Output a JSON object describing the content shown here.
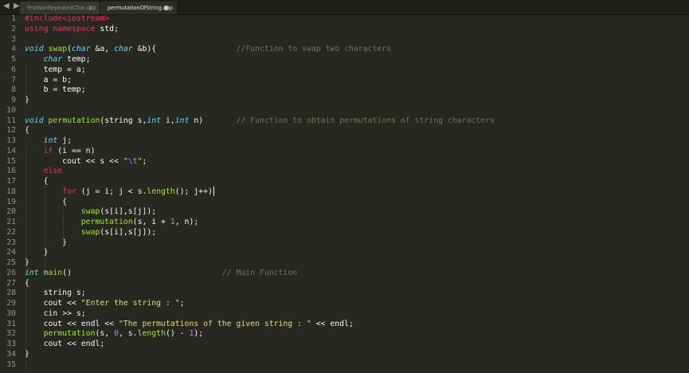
{
  "tabs": [
    {
      "label": "firstNonRepeatedChar.cpp",
      "active": false,
      "close_glyph": "×"
    },
    {
      "label": "permutationOfString.cpp",
      "active": true,
      "modified_glyph": "●"
    }
  ],
  "nav_arrows": "◀ ▶",
  "editor": {
    "caret_line": 18,
    "lines": [
      {
        "n": "1",
        "tokens": [
          {
            "t": "#include<iostream>",
            "c": "kw"
          }
        ]
      },
      {
        "n": "2",
        "tokens": [
          {
            "t": "using namespace",
            "c": "kw"
          },
          {
            "t": " std;",
            "c": "tx"
          }
        ]
      },
      {
        "n": "3",
        "tokens": []
      },
      {
        "n": "4",
        "tokens": [
          {
            "t": "void",
            "c": "ty"
          },
          {
            "t": " ",
            "c": "tx"
          },
          {
            "t": "swap",
            "c": "fn"
          },
          {
            "t": "(",
            "c": "tx"
          },
          {
            "t": "char",
            "c": "ty"
          },
          {
            "t": " &a, ",
            "c": "tx"
          },
          {
            "t": "char",
            "c": "ty"
          },
          {
            "t": " &b){                 ",
            "c": "tx"
          },
          {
            "t": "//Function to swap two characters",
            "c": "cm"
          }
        ]
      },
      {
        "n": "5",
        "tokens": [
          {
            "t": "    ",
            "c": "tx"
          },
          {
            "t": "char",
            "c": "ty"
          },
          {
            "t": " temp;",
            "c": "tx"
          }
        ]
      },
      {
        "n": "6",
        "tokens": [
          {
            "t": "    temp = a;",
            "c": "tx"
          }
        ]
      },
      {
        "n": "7",
        "tokens": [
          {
            "t": "    a = b;",
            "c": "tx"
          }
        ]
      },
      {
        "n": "8",
        "tokens": [
          {
            "t": "    b = temp;",
            "c": "tx"
          }
        ]
      },
      {
        "n": "9",
        "tokens": [
          {
            "t": "}",
            "c": "tx"
          }
        ]
      },
      {
        "n": "10",
        "tokens": []
      },
      {
        "n": "11",
        "tokens": [
          {
            "t": "void",
            "c": "ty"
          },
          {
            "t": " ",
            "c": "tx"
          },
          {
            "t": "permutation",
            "c": "fn"
          },
          {
            "t": "(string s,",
            "c": "tx"
          },
          {
            "t": "int",
            "c": "ty"
          },
          {
            "t": " i,",
            "c": "tx"
          },
          {
            "t": "int",
            "c": "ty"
          },
          {
            "t": " n)       ",
            "c": "tx"
          },
          {
            "t": "// Function to obtain permutations of string characters",
            "c": "cm"
          }
        ]
      },
      {
        "n": "12",
        "tokens": [
          {
            "t": "{",
            "c": "tx"
          }
        ]
      },
      {
        "n": "13",
        "tokens": [
          {
            "t": "    ",
            "c": "tx"
          },
          {
            "t": "int",
            "c": "ty"
          },
          {
            "t": " j;",
            "c": "tx"
          }
        ]
      },
      {
        "n": "14",
        "tokens": [
          {
            "t": "    ",
            "c": "tx"
          },
          {
            "t": "if",
            "c": "kw"
          },
          {
            "t": " (i == n)",
            "c": "tx"
          }
        ]
      },
      {
        "n": "15",
        "tokens": [
          {
            "t": "        cout << s << ",
            "c": "tx"
          },
          {
            "t": "\"",
            "c": "st"
          },
          {
            "t": "\\t",
            "c": "es"
          },
          {
            "t": "\"",
            "c": "st"
          },
          {
            "t": ";",
            "c": "tx"
          }
        ]
      },
      {
        "n": "16",
        "tokens": [
          {
            "t": "    ",
            "c": "tx"
          },
          {
            "t": "else",
            "c": "kw"
          }
        ]
      },
      {
        "n": "17",
        "tokens": [
          {
            "t": "    {",
            "c": "tx"
          }
        ]
      },
      {
        "n": "18",
        "tokens": [
          {
            "t": "        ",
            "c": "tx"
          },
          {
            "t": "for",
            "c": "kw"
          },
          {
            "t": " (j = i; j < s.",
            "c": "tx"
          },
          {
            "t": "length",
            "c": "fn"
          },
          {
            "t": "(); j++)",
            "c": "tx"
          }
        ]
      },
      {
        "n": "19",
        "tokens": [
          {
            "t": "        {",
            "c": "tx"
          }
        ]
      },
      {
        "n": "20",
        "tokens": [
          {
            "t": "            ",
            "c": "tx"
          },
          {
            "t": "swap",
            "c": "fn"
          },
          {
            "t": "(s[i],s[j]);",
            "c": "tx"
          }
        ]
      },
      {
        "n": "21",
        "tokens": [
          {
            "t": "            ",
            "c": "tx"
          },
          {
            "t": "permutation",
            "c": "fn"
          },
          {
            "t": "(s, i + ",
            "c": "tx"
          },
          {
            "t": "1",
            "c": "nm"
          },
          {
            "t": ", n);",
            "c": "tx"
          }
        ]
      },
      {
        "n": "22",
        "tokens": [
          {
            "t": "            ",
            "c": "tx"
          },
          {
            "t": "swap",
            "c": "fn"
          },
          {
            "t": "(s[i],s[j]);",
            "c": "tx"
          }
        ]
      },
      {
        "n": "23",
        "tokens": [
          {
            "t": "        }",
            "c": "tx"
          }
        ]
      },
      {
        "n": "24",
        "tokens": [
          {
            "t": "    }",
            "c": "tx"
          }
        ]
      },
      {
        "n": "25",
        "tokens": [
          {
            "t": "}",
            "c": "tx"
          }
        ]
      },
      {
        "n": "26",
        "tokens": [
          {
            "t": "int",
            "c": "ty"
          },
          {
            "t": " ",
            "c": "tx"
          },
          {
            "t": "main",
            "c": "fn"
          },
          {
            "t": "()                                ",
            "c": "tx"
          },
          {
            "t": "// Main Function",
            "c": "cm"
          }
        ]
      },
      {
        "n": "27",
        "tokens": [
          {
            "t": "{",
            "c": "tx"
          }
        ]
      },
      {
        "n": "28",
        "tokens": [
          {
            "t": "    string s;",
            "c": "tx"
          }
        ]
      },
      {
        "n": "29",
        "tokens": [
          {
            "t": "    cout << ",
            "c": "tx"
          },
          {
            "t": "\"Enter the string : \"",
            "c": "st"
          },
          {
            "t": ";",
            "c": "tx"
          }
        ]
      },
      {
        "n": "30",
        "tokens": [
          {
            "t": "    cin >> s;",
            "c": "tx"
          }
        ]
      },
      {
        "n": "31",
        "tokens": [
          {
            "t": "    cout << endl << ",
            "c": "tx"
          },
          {
            "t": "\"The permutations of the given string : \"",
            "c": "st"
          },
          {
            "t": " << endl;",
            "c": "tx"
          }
        ]
      },
      {
        "n": "32",
        "tokens": [
          {
            "t": "    ",
            "c": "tx"
          },
          {
            "t": "permutation",
            "c": "fn"
          },
          {
            "t": "(s, ",
            "c": "tx"
          },
          {
            "t": "0",
            "c": "nm"
          },
          {
            "t": ", s.",
            "c": "tx"
          },
          {
            "t": "length",
            "c": "fn"
          },
          {
            "t": "() - ",
            "c": "tx"
          },
          {
            "t": "1",
            "c": "nm"
          },
          {
            "t": ");",
            "c": "tx"
          }
        ]
      },
      {
        "n": "33",
        "tokens": [
          {
            "t": "    cout << endl;",
            "c": "tx"
          }
        ]
      },
      {
        "n": "34",
        "tokens": [
          {
            "t": "}",
            "c": "tx"
          }
        ]
      },
      {
        "n": "35",
        "tokens": []
      }
    ]
  }
}
